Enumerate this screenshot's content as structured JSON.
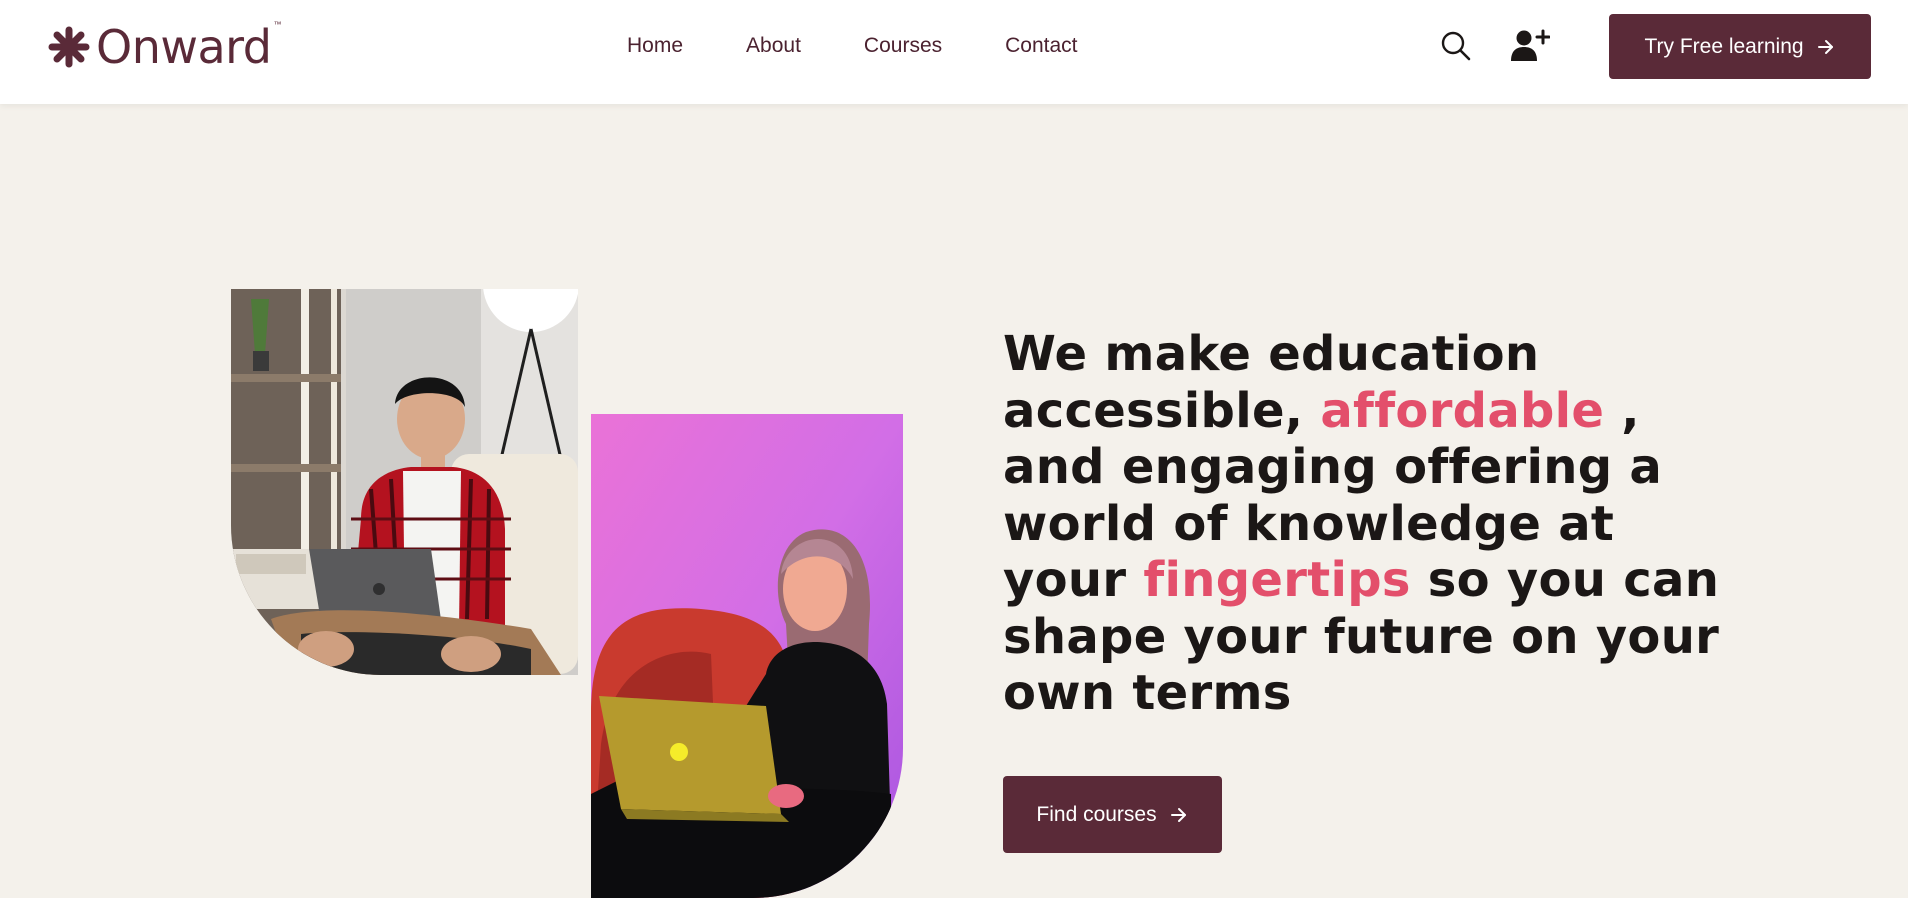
{
  "brand": {
    "name": "Onward",
    "trademark": "™",
    "color": "#5a2a38"
  },
  "nav": {
    "items": [
      {
        "label": "Home"
      },
      {
        "label": "About"
      },
      {
        "label": "Courses"
      },
      {
        "label": "Contact"
      }
    ]
  },
  "header_icons": {
    "search": "search-icon",
    "account": "add-user-icon"
  },
  "header_cta": {
    "label": "Try Free learning",
    "icon": "arrow-right-icon"
  },
  "hero": {
    "headline": {
      "part1": "We make education accessible, ",
      "highlight1": "affordable",
      "part2": " , and engaging offering a world of knowledge at your ",
      "highlight2": "fingertips",
      "part3": " so you can shape your future on your own terms"
    },
    "button": {
      "label": "Find courses",
      "icon": "arrow-right-icon"
    }
  },
  "colors": {
    "accent": "#5a2a38",
    "highlight": "#e34f6b",
    "background": "#f4f1eb",
    "text": "#1b1716"
  }
}
